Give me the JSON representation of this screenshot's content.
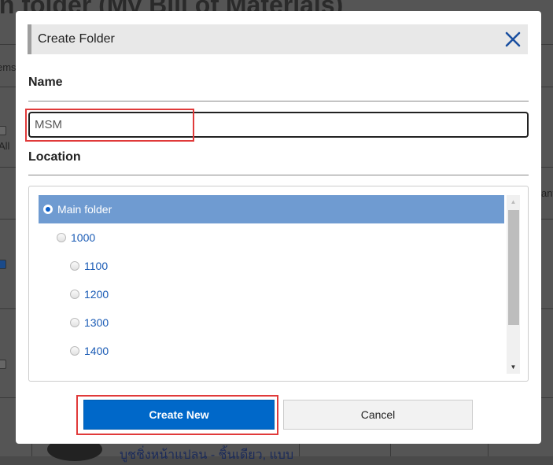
{
  "background": {
    "page_title_fragment": "in folder (My Bill of Materials)",
    "column_fragment_left": "ems",
    "check_label_fragment": "All",
    "column_fragment_right": "ant",
    "row_text_fragment": "บูชชิ่งหน้าแปลน - ชิ้นเดียว, แบบ"
  },
  "dialog": {
    "title": "Create Folder",
    "close_icon": "close-x-icon",
    "name_label": "Name",
    "name_value": "MSM",
    "location_label": "Location",
    "tree": [
      {
        "label": "Main folder",
        "level": 0,
        "selected": true
      },
      {
        "label": "1000",
        "level": 1,
        "selected": false
      },
      {
        "label": "1100",
        "level": 2,
        "selected": false
      },
      {
        "label": "1200",
        "level": 2,
        "selected": false
      },
      {
        "label": "1300",
        "level": 2,
        "selected": false
      },
      {
        "label": "1400",
        "level": 2,
        "selected": false
      }
    ],
    "buttons": {
      "create": "Create New",
      "cancel": "Cancel"
    }
  },
  "colors": {
    "primary": "#0068c9",
    "selected_row": "#6f9bd1",
    "link": "#1a5bb5",
    "highlight": "#e03a3a",
    "close_icon": "#1a4fa0"
  }
}
